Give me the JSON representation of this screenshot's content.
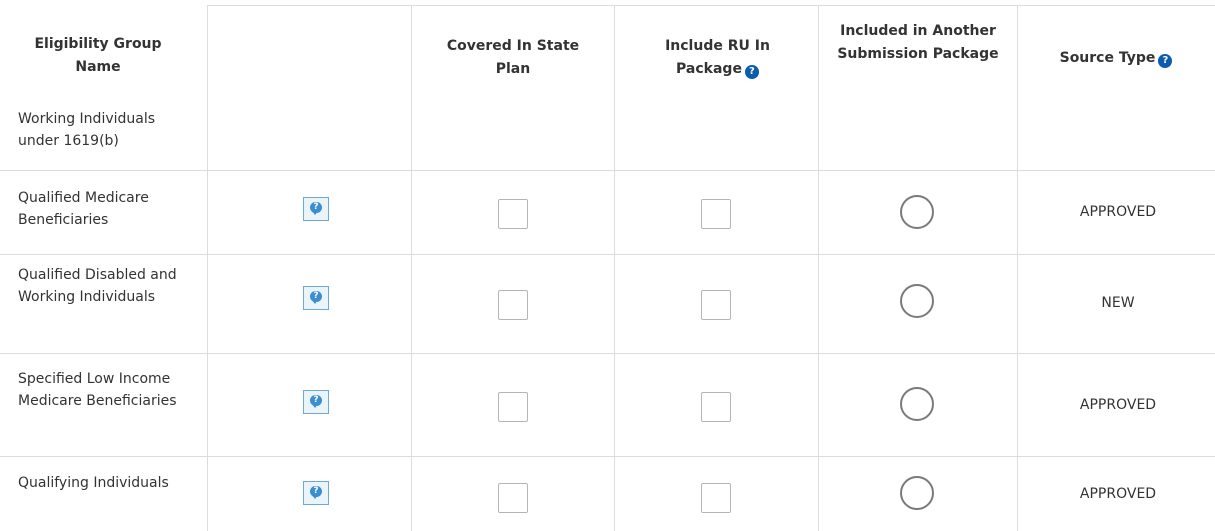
{
  "headers": {
    "group_name": "Eligibility Group Name",
    "covered": "Covered In State Plan",
    "include_ru": "Include RU In Package",
    "included_another": "Included in Another Submission Package",
    "source_type": "Source Type"
  },
  "section_label": "Working Individuals under 1619(b)",
  "rows": [
    {
      "name": "Qualified Medicare Beneficiaries",
      "source": "APPROVED"
    },
    {
      "name": "Qualified Disabled and Working Individuals",
      "source": "NEW"
    },
    {
      "name": "Specified Low Income Medicare Beneficiaries",
      "source": "APPROVED"
    },
    {
      "name": "Qualifying Individuals",
      "source": "APPROVED"
    }
  ],
  "icons": {
    "help": "question-circle-icon",
    "comment": "comment-bubble-icon"
  },
  "colors": {
    "border": "#dcdcdc",
    "help_icon": "#0a5cad",
    "comment_icon": "#3b8ed0"
  }
}
